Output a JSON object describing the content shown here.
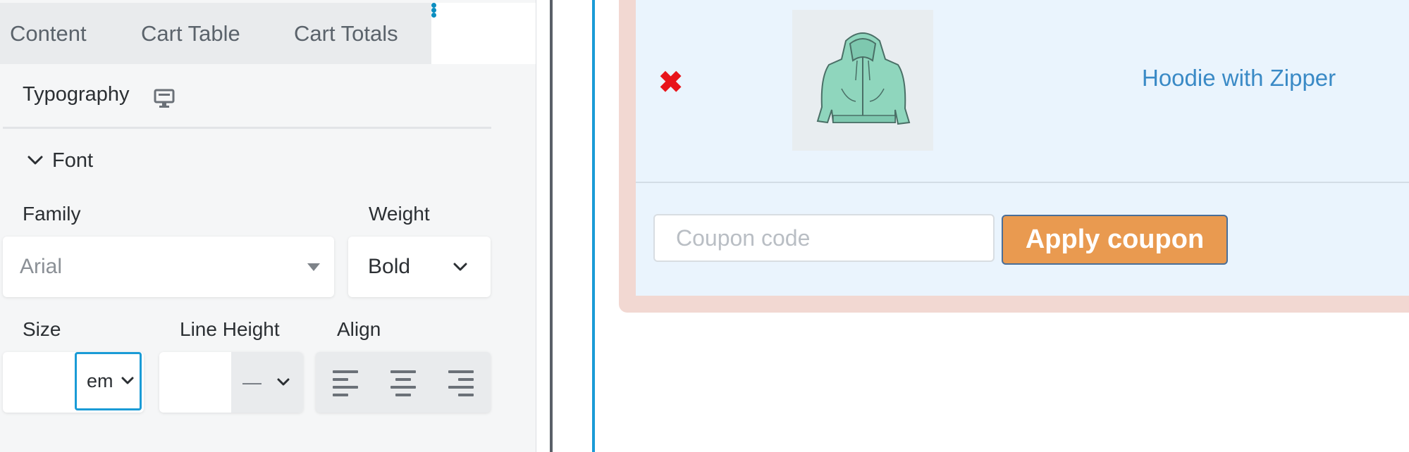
{
  "panel": {
    "tabs": [
      {
        "label": "Content"
      },
      {
        "label": "Cart Table"
      },
      {
        "label": "Cart Totals"
      }
    ],
    "more_tab_icon": "more-dots-icon",
    "section_title": "Typography",
    "device_icon": "desktop-icon",
    "font_group": {
      "label": "Font",
      "expanded": true,
      "family": {
        "label": "Family",
        "value": "Arial"
      },
      "weight": {
        "label": "Weight",
        "value": "Bold"
      },
      "size": {
        "label": "Size",
        "value": "",
        "unit": "em"
      },
      "line_height": {
        "label": "Line Height",
        "value": "",
        "unit": "—"
      },
      "align": {
        "label": "Align",
        "options": [
          "left",
          "center",
          "right"
        ]
      }
    }
  },
  "preview": {
    "product": {
      "name": "Hoodie with Zipper",
      "image_icon": "hoodie-image",
      "remove_icon": "remove-x-icon"
    },
    "coupon": {
      "placeholder": "Coupon code",
      "value": "",
      "button_label": "Apply coupon"
    }
  },
  "colors": {
    "accent": "#1a9bd6",
    "remove": "#e8141a",
    "link": "#3a8ac6",
    "button": "#e99a50",
    "cart_border": "#f2d8d2",
    "cart_bg": "#eaf4fd"
  }
}
